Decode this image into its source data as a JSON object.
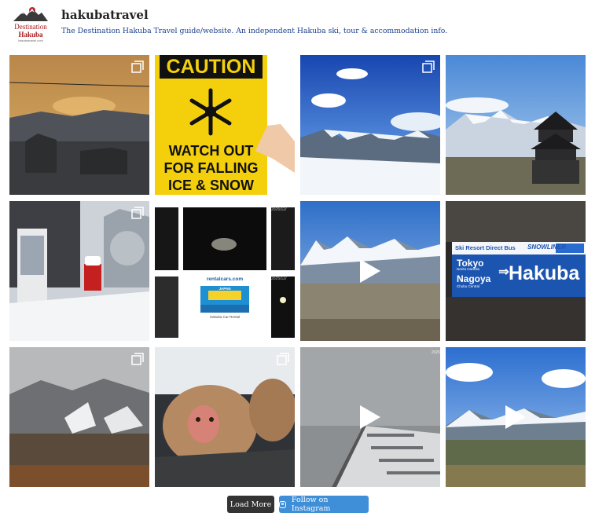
{
  "profile": {
    "logo_line1": "Destination",
    "logo_line2": "Hakuba",
    "logo_line3": "hakubatravel.com",
    "username": "hakubatravel",
    "bio": "The Destination Hakuba Travel guide/website. An independent Hakuba ski, tour & accommodation info."
  },
  "posts": [
    {
      "type": "carousel"
    },
    {
      "type": "image",
      "sign_line1": "CAUTION",
      "sign_line2": "WATCH OUT",
      "sign_line3": "FOR FALLING",
      "sign_line4": "ICE & SNOW"
    },
    {
      "type": "carousel"
    },
    {
      "type": "image"
    },
    {
      "type": "carousel"
    },
    {
      "type": "image",
      "banner_site": "rentalcars.com",
      "banner_line1": "CHEAP CAR HIRE",
      "banner_line2": "JAPAN",
      "banner_caption": "Hakuba Car Rental",
      "cam_date_1": "2025/12/",
      "cam_date_2": "2025/12/"
    },
    {
      "type": "video"
    },
    {
      "type": "image",
      "bus_heading": "Ski Resort Direct Bus",
      "bus_brand": "SNOWLINER",
      "bus_from1": "Tokyo",
      "bus_from2": "Nagoya",
      "bus_to": "Hakuba",
      "bus_sub1": "Narita Haneda",
      "bus_sub2": "Chubu Central"
    },
    {
      "type": "carousel"
    },
    {
      "type": "carousel"
    },
    {
      "type": "video",
      "cam_date": "2025"
    },
    {
      "type": "video"
    }
  ],
  "buttons": {
    "load_more": "Load More",
    "follow": "Follow on Instagram"
  },
  "colors": {
    "bio_link": "#1a3f8f",
    "load_more_bg": "#333333",
    "follow_bg": "#3e8ed8",
    "logo_red": "#a8161b"
  }
}
